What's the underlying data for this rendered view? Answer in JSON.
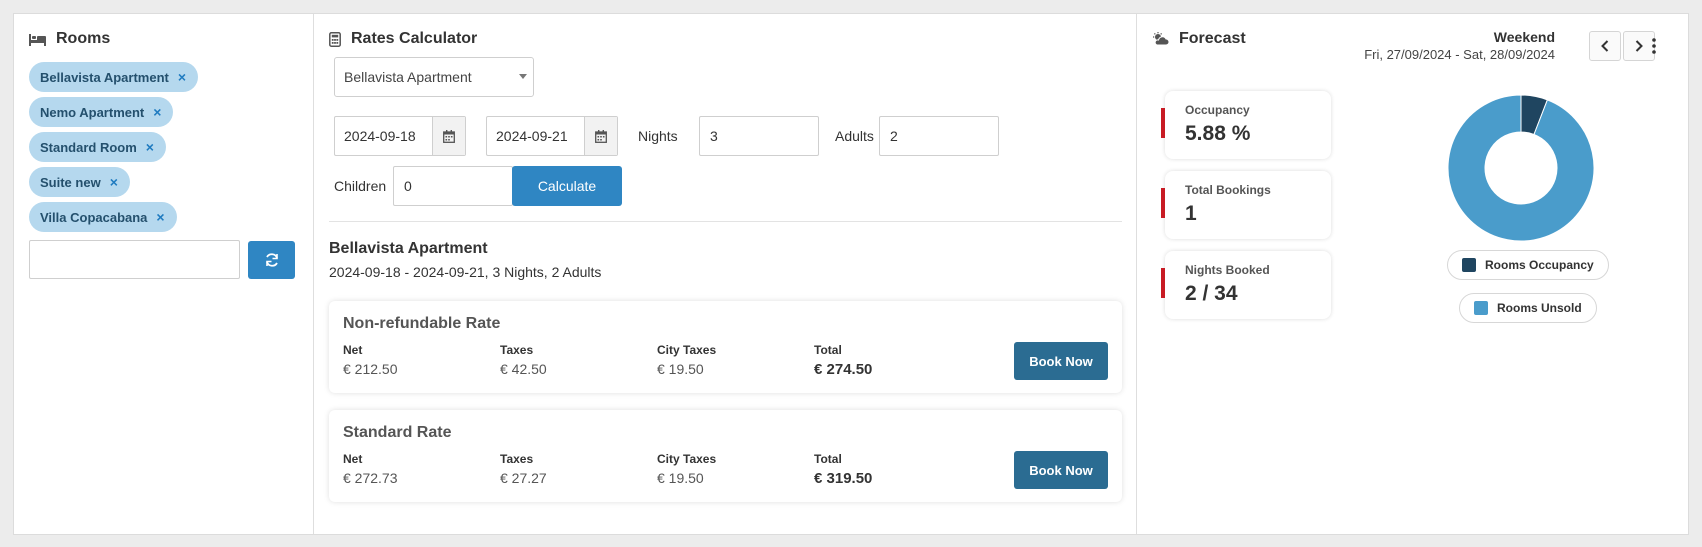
{
  "rooms": {
    "title": "Rooms",
    "chips": [
      "Bellavista Apartment",
      "Nemo Apartment",
      "Standard Room",
      "Suite new",
      "Villa Copacabana"
    ],
    "chip_remove": "×",
    "search_value": ""
  },
  "rates": {
    "title": "Rates Calculator",
    "selected_room": "Bellavista Apartment",
    "checkin": "2024-09-18",
    "checkout": "2024-09-21",
    "nights_label": "Nights",
    "nights": "3",
    "adults_label": "Adults",
    "adults": "2",
    "children_label": "Children",
    "children": "0",
    "calculate_label": "Calculate",
    "result_title": "Bellavista Apartment",
    "result_subtitle": "2024-09-18 - 2024-09-21, 3 Nights, 2 Adults",
    "col_headers": {
      "net": "Net",
      "taxes": "Taxes",
      "city": "City Taxes",
      "total": "Total"
    },
    "book_label": "Book Now",
    "items": [
      {
        "name": "Non-refundable Rate",
        "net": "€ 212.50",
        "taxes": "€ 42.50",
        "city": "€ 19.50",
        "total": "€ 274.50"
      },
      {
        "name": "Standard Rate",
        "net": "€ 272.73",
        "taxes": "€ 27.27",
        "city": "€ 19.50",
        "total": "€ 319.50"
      }
    ]
  },
  "forecast": {
    "title": "Forecast",
    "period": "Weekend",
    "range": "Fri, 27/09/2024 - Sat, 28/09/2024",
    "kpis": [
      {
        "label": "Occupancy",
        "value": "5.88 %"
      },
      {
        "label": "Total Bookings",
        "value": "1"
      },
      {
        "label": "Nights Booked",
        "value": "2 / 34"
      }
    ],
    "accent": "#c81b24"
  },
  "chart_data": {
    "type": "pie",
    "donut": true,
    "categories": [
      "Rooms Occupancy",
      "Rooms Unsold"
    ],
    "values": [
      5.88,
      94.12
    ],
    "colors": [
      "#1f4560",
      "#4a9ccb"
    ],
    "legend_placement": "bottom"
  }
}
